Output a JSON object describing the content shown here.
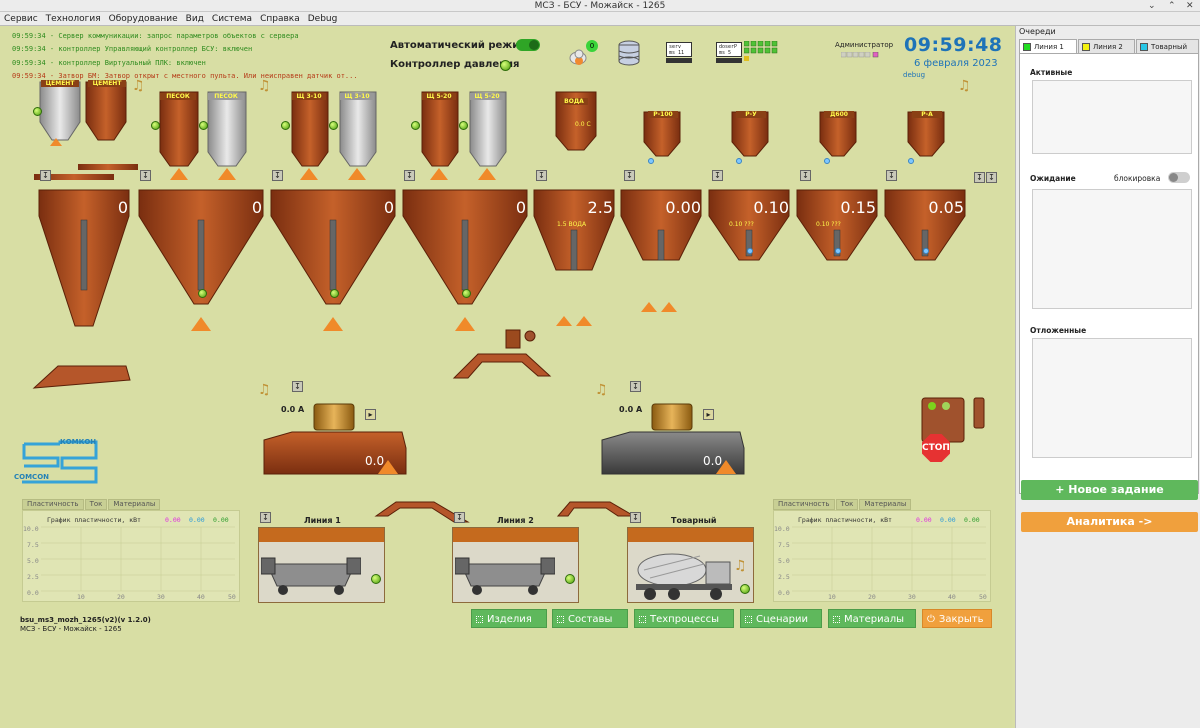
{
  "window": {
    "title": "МСЗ - БСУ - Можайск - 1265"
  },
  "menu": [
    "Сервис",
    "Технология",
    "Оборудование",
    "Вид",
    "Система",
    "Справка",
    "Debug"
  ],
  "log": [
    {
      "text": "09:59:34 - Сервер коммуникации: запрос параметров объектов с сервера",
      "level": "ok"
    },
    {
      "text": "09:59:34 - контроллер Управляющий контроллер БСУ: включен",
      "level": "ok"
    },
    {
      "text": "09:59:34 - контроллер Виртуальный ПЛК: включен",
      "level": "ok"
    },
    {
      "text": "09:59:34 - Затвор БМ: Затвор открыт с местного пульта. Или неисправен датчик от...",
      "level": "err"
    }
  ],
  "modes": {
    "auto_label": "Автоматический режим",
    "pressure_label": "Контроллер давления"
  },
  "status": {
    "badge": "0",
    "server_box": "serv\nms 11",
    "doser_box": "doserP\nms 5",
    "admin": "Администратор",
    "clock": "09:59:48",
    "date": "6 февраля 2023",
    "debug": "debug"
  },
  "silos": [
    {
      "label": "ЦЕМЕНТ"
    },
    {
      "label": "ЦЕМЕНТ"
    },
    {
      "label": "ПЕСОК"
    },
    {
      "label": "ПЕСОК"
    },
    {
      "label": "Щ 3-10"
    },
    {
      "label": "Щ 3-10"
    },
    {
      "label": "Щ 5-20"
    },
    {
      "label": "Щ 5-20"
    },
    {
      "label": "ВОДА"
    },
    {
      "label": "Р-100"
    },
    {
      "label": "Р-У"
    },
    {
      "label": "Д600"
    },
    {
      "label": "Р-А"
    }
  ],
  "water_tank_value": "0.0 С",
  "hoppers": [
    {
      "value": "0"
    },
    {
      "value": "0"
    },
    {
      "value": "0"
    },
    {
      "value": "0"
    },
    {
      "value": "2.5",
      "sub": "1.5  ВОДА"
    },
    {
      "value": "0.00"
    },
    {
      "value": "0.10",
      "sub": "0.10  ???"
    },
    {
      "value": "0.15",
      "sub": "0.10  ???"
    },
    {
      "value": "0.05"
    }
  ],
  "mixers": [
    {
      "amp": "0.0 А",
      "value": "0.0"
    },
    {
      "amp": "0.0 А",
      "value": "0.0"
    }
  ],
  "charts": [
    {
      "tabs": [
        "Пластичность",
        "Ток",
        "Материалы"
      ],
      "title": "График пластичности, кВт",
      "readouts": [
        {
          "v": "0.00",
          "color": "#e030e0"
        },
        {
          "v": "0.00",
          "color": "#2a9ad8"
        },
        {
          "v": "0.00",
          "color": "#2e9e2e"
        }
      ],
      "y_ticks": [
        "10.0",
        "7.5",
        "5.0",
        "2.5",
        "0.0"
      ],
      "x_ticks": [
        "10",
        "20",
        "30",
        "40",
        "50"
      ]
    },
    {
      "tabs": [
        "Пластичность",
        "Ток",
        "Материалы"
      ],
      "title": "График пластичности, кВт",
      "readouts": [
        {
          "v": "0.00",
          "color": "#e030e0"
        },
        {
          "v": "0.00",
          "color": "#2a9ad8"
        },
        {
          "v": "0.00",
          "color": "#2e9e2e"
        }
      ],
      "y_ticks": [
        "10.0",
        "7.5",
        "5.0",
        "2.5",
        "0.0"
      ],
      "x_ticks": [
        "10",
        "20",
        "30",
        "40",
        "50"
      ]
    }
  ],
  "lines": [
    {
      "label": "Линия  1"
    },
    {
      "label": "Линия  2"
    },
    {
      "label": "Товарный"
    }
  ],
  "bottom_buttons": [
    {
      "label": "Изделия"
    },
    {
      "label": "Составы"
    },
    {
      "label": "Техпроцессы"
    },
    {
      "label": "Сценарии"
    },
    {
      "label": "Материалы"
    },
    {
      "label": "Закрыть"
    }
  ],
  "app_info": {
    "version": "bsu_ms3_mozh_1265(v2)(v 1.2.0)",
    "name": "МСЗ - БСУ - Можайск - 1265"
  },
  "logo": {
    "top": "КОМКОН",
    "bottom": "COMCON"
  },
  "stop_label": "СТОП",
  "side": {
    "title": "Очереди",
    "tabs": [
      {
        "label": "Линия 1",
        "color": "#22dd22"
      },
      {
        "label": "Линия 2",
        "color": "#f4f20f"
      },
      {
        "label": "Товарный",
        "color": "#28c7e6"
      }
    ],
    "active_label": "Активные",
    "waiting_label": "Ожидание",
    "lock_label": "блокировка",
    "postponed_label": "Отложенные",
    "new_task": "+ Новое задание",
    "analytics": "Аналитика ->"
  }
}
